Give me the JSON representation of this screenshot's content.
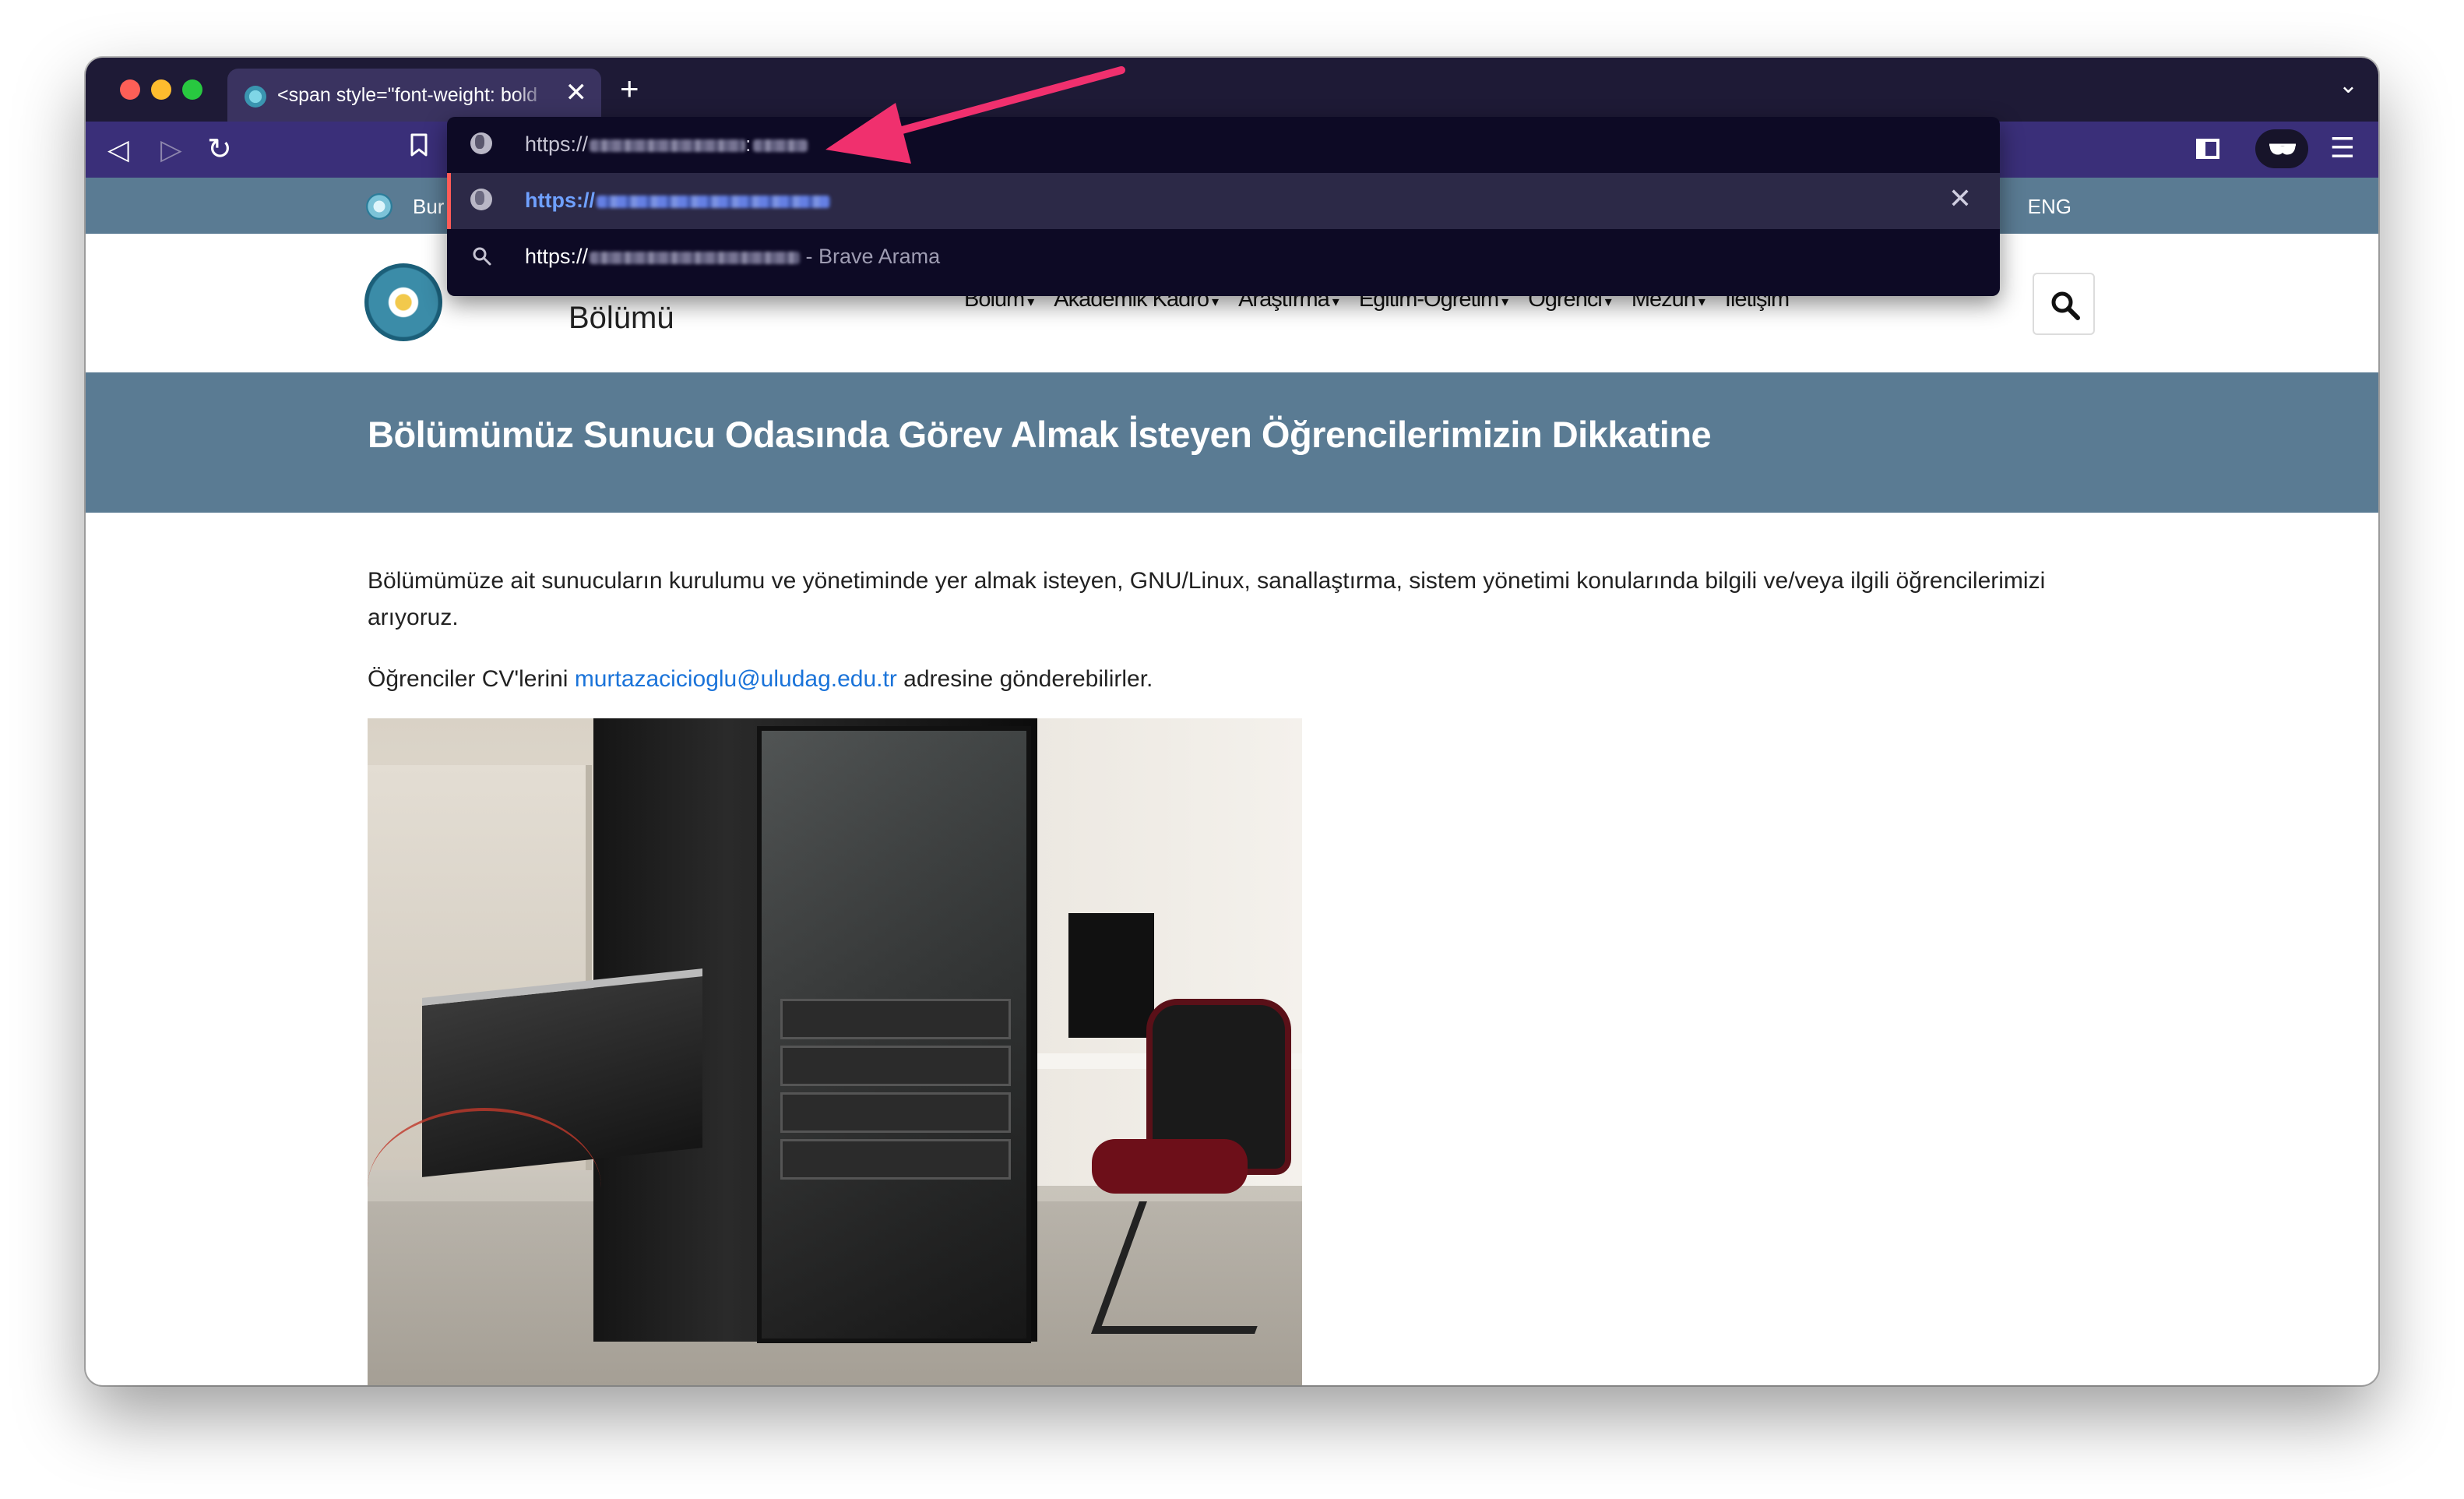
{
  "browser": {
    "tab_title": "<span style=\"font-weight: bold",
    "tab_close": "✕",
    "new_tab": "+",
    "tab_menu": "⌄",
    "nav_back": "◁",
    "nav_forward": "▷",
    "reload": "↻",
    "menu": "☰"
  },
  "omnibox": {
    "input_prefix": "https://",
    "input_suffix": ":",
    "suggestion_url_prefix": "https://",
    "search_prefix": "https://",
    "search_suffix": " - Brave Arama",
    "remove": "✕"
  },
  "site": {
    "utility_text": "Bur",
    "lang_toggle": "ENG",
    "department_name": "Bölümü",
    "nav": [
      {
        "label": "Bölüm",
        "has_caret": true
      },
      {
        "label": "Akademik Kadro",
        "has_caret": true
      },
      {
        "label": "Araştırma",
        "has_caret": true
      },
      {
        "label": "Eğitim-Öğretim",
        "has_caret": true
      },
      {
        "label": "Öğrenci",
        "has_caret": true
      },
      {
        "label": "Mezun",
        "has_caret": true
      },
      {
        "label": "İletişim",
        "has_caret": false
      }
    ],
    "caret": "▾"
  },
  "article": {
    "title": "Bölümümüz Sunucu Odasında Görev Almak İsteyen Öğrencilerimizin Dikkatine",
    "paragraph1": "Bölümümüze ait sunucuların kurulumu ve yönetiminde yer almak isteyen, GNU/Linux, sanallaştırma, sistem yönetimi konularında bilgili ve/veya ilgili öğrencilerimizi arıyoruz.",
    "paragraph2_before": "Öğrenciler CV'lerini ",
    "email": "murtazacicioglu@uludag.edu.tr",
    "paragraph2_after": " adresine gönderebilirler."
  },
  "colors": {
    "tabbar": "#1e1a36",
    "toolbar": "#3a2f79",
    "omnibox_bg": "#0d0a25",
    "site_accent": "#5a7b93",
    "link": "#1a73d9",
    "annotation_arrow": "#f0306e"
  },
  "icons": {
    "site_search": "search-icon",
    "reader_mode": "reader-mode-icon",
    "sidebar": "sidebar-icon",
    "bookmark": "bookmark-icon"
  }
}
